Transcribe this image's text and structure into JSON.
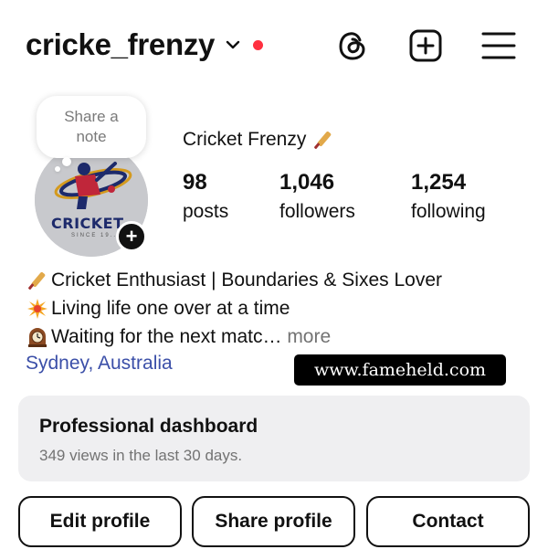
{
  "header": {
    "username": "cricke_frenzy",
    "icons": [
      "threads-icon",
      "create-post-icon",
      "menu-icon"
    ],
    "notification_dot_color": "#ff3040"
  },
  "note": {
    "line1": "Share a",
    "line2": "note"
  },
  "avatar": {
    "text": "CRICKET",
    "subtext": "SINCE 19..",
    "add_symbol": "+"
  },
  "profile": {
    "display_name": "Cricket Frenzy",
    "name_emoji": "cricket-bat-icon"
  },
  "stats": {
    "posts": {
      "value": "98",
      "label": "posts"
    },
    "followers": {
      "value": "1,046",
      "label": "followers"
    },
    "following": {
      "value": "1,254",
      "label": "following"
    }
  },
  "bio": {
    "line1": "Cricket Enthusiast | Boundaries & Sixes Lover",
    "line2": "Living life one over at a time",
    "line3": "Waiting for the next matc",
    "ellipsis": "…",
    "more_label": " more",
    "location": "Sydney, Australia"
  },
  "watermark": "www.fameheld.com",
  "dashboard": {
    "title": "Professional dashboard",
    "subtitle": "349 views in the last 30 days."
  },
  "buttons": {
    "edit": "Edit profile",
    "share": "Share profile",
    "contact": "Contact"
  },
  "colors": {
    "link": "#3b4fa8",
    "muted": "#737373",
    "dashboard_bg": "#efeff1"
  }
}
